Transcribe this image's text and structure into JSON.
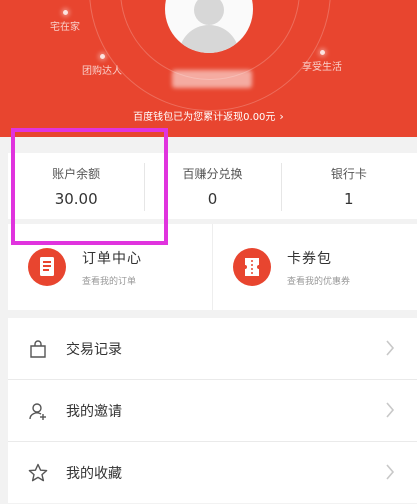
{
  "header": {
    "tags": {
      "home": "宅在家",
      "group_buy": "团购达人",
      "enjoy_life": "享受生活"
    },
    "savings_text": "百度钱包已为您累计返现0.00元",
    "savings_chevron": "›",
    "accent": "#e8452f"
  },
  "stats": [
    {
      "label": "账户余额",
      "value": "30.00"
    },
    {
      "label": "百赚分兑换",
      "value": "0"
    },
    {
      "label": "银行卡",
      "value": "1"
    }
  ],
  "cards": [
    {
      "title": "订单中心",
      "subtitle": "查看我的订单",
      "icon": "order-document-icon"
    },
    {
      "title": "卡券包",
      "subtitle": "查看我的优惠券",
      "icon": "coupon-ticket-icon"
    }
  ],
  "list": [
    {
      "label": "交易记录",
      "icon": "shopping-bag-icon"
    },
    {
      "label": "我的邀请",
      "icon": "invite-user-icon"
    },
    {
      "label": "我的收藏",
      "icon": "star-icon"
    }
  ],
  "highlight_color": "#e033de"
}
